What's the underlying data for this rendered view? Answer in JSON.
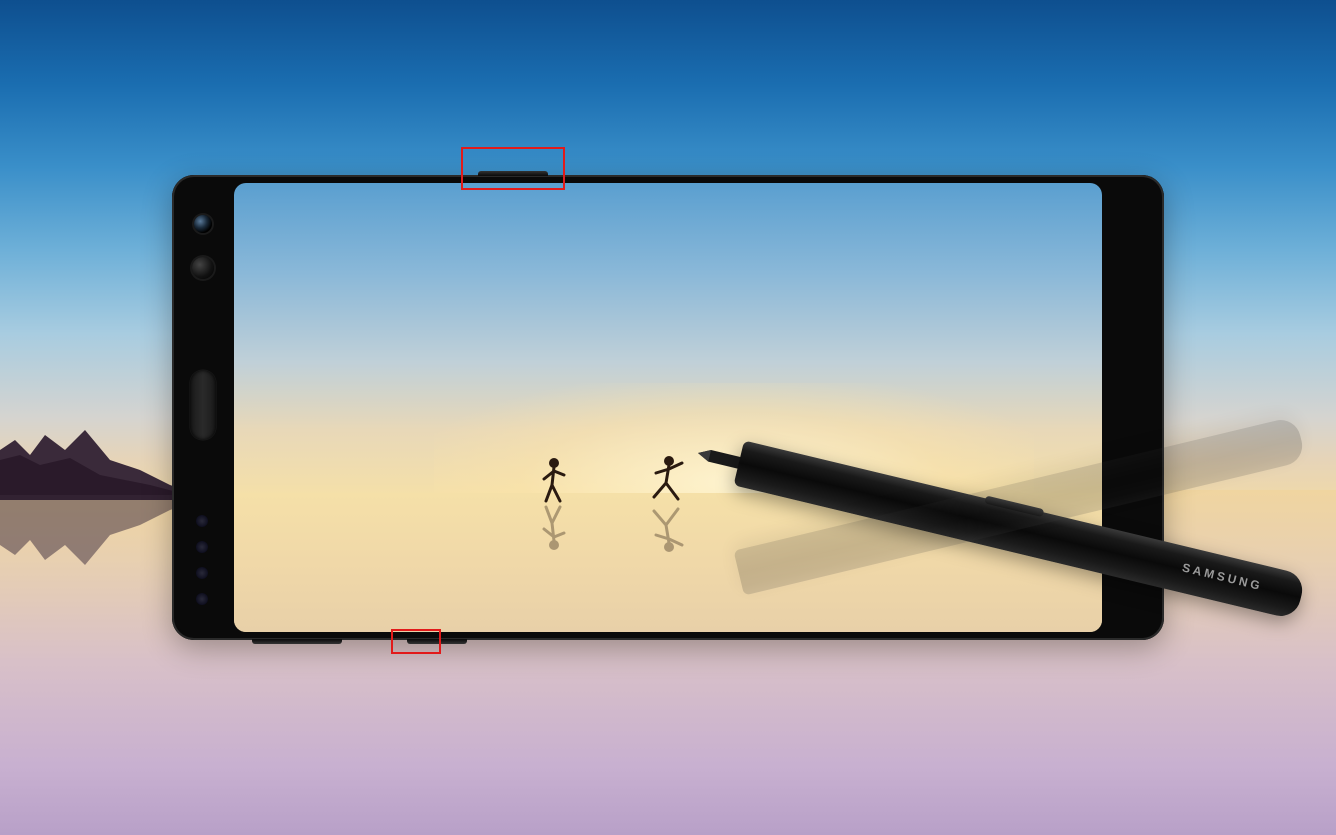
{
  "device": {
    "brand_label": "SAMSUNG"
  },
  "annotations": {
    "top_box": "power-button-callout",
    "bottom_box": "volume-gap-callout"
  },
  "colors": {
    "annotation_border": "#e21a1a",
    "phone_body": "#0a0a0a"
  }
}
